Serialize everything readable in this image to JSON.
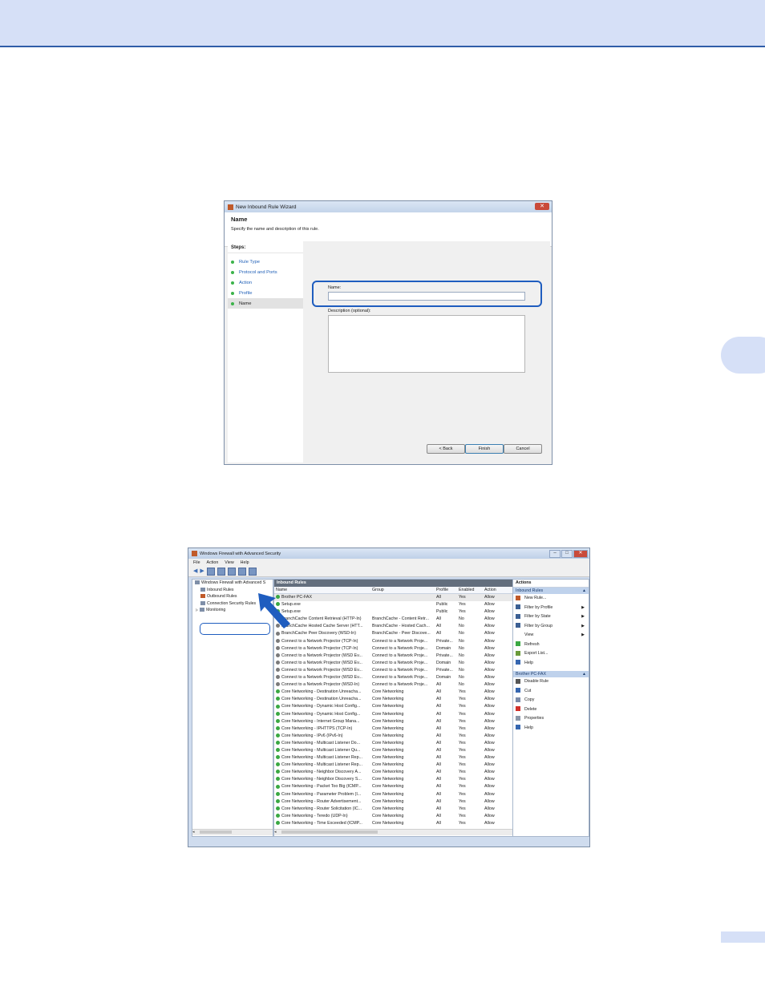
{
  "wizard": {
    "title": "New Inbound Rule Wizard",
    "heading": "Name",
    "subheading": "Specify the name and description of this rule.",
    "steps_label": "Steps:",
    "steps": [
      "Rule Type",
      "Protocol and Ports",
      "Action",
      "Profile",
      "Name"
    ],
    "name_label": "Name:",
    "name_value": "",
    "desc_label": "Description (optional):",
    "desc_value": "",
    "back_label": "< Back",
    "finish_label": "Finish",
    "cancel_label": "Cancel",
    "close_glyph": "✕"
  },
  "firewall": {
    "title": "Windows Firewall with Advanced Security",
    "menu": [
      "File",
      "Action",
      "View",
      "Help"
    ],
    "tree": [
      "Windows Firewall with Advanced S",
      "Inbound Rules",
      "Outbound Rules",
      "Connection Security Rules",
      "Monitoring"
    ],
    "grid_title": "Inbound Rules",
    "columns": [
      "Name",
      "Group",
      "Profile",
      "Enabled",
      "Action"
    ],
    "rows": [
      {
        "n": "Brother PC-FAX",
        "g": "",
        "p": "All",
        "e": "Yes",
        "a": "Allow",
        "i": "g"
      },
      {
        "n": "Setup.exe",
        "g": "",
        "p": "Public",
        "e": "Yes",
        "a": "Allow",
        "i": "g"
      },
      {
        "n": "Setup.exe",
        "g": "",
        "p": "Public",
        "e": "Yes",
        "a": "Allow",
        "i": "g"
      },
      {
        "n": "BranchCache Content Retrieval (HTTP-In)",
        "g": "BranchCache - Content Retr...",
        "p": "All",
        "e": "No",
        "a": "Allow",
        "i": "d"
      },
      {
        "n": "BranchCache Hosted Cache Server (HTT...",
        "g": "BranchCache - Hosted Cach...",
        "p": "All",
        "e": "No",
        "a": "Allow",
        "i": "d"
      },
      {
        "n": "BranchCache Peer Discovery (WSD-In)",
        "g": "BranchCache - Peer Discove...",
        "p": "All",
        "e": "No",
        "a": "Allow",
        "i": "d"
      },
      {
        "n": "Connect to a Network Projector (TCP-In)",
        "g": "Connect to a Network Proje...",
        "p": "Private...",
        "e": "No",
        "a": "Allow",
        "i": "d"
      },
      {
        "n": "Connect to a Network Projector (TCP-In)",
        "g": "Connect to a Network Proje...",
        "p": "Domain",
        "e": "No",
        "a": "Allow",
        "i": "d"
      },
      {
        "n": "Connect to a Network Projector (WSD Ev...",
        "g": "Connect to a Network Proje...",
        "p": "Private...",
        "e": "No",
        "a": "Allow",
        "i": "d"
      },
      {
        "n": "Connect to a Network Projector (WSD Ev...",
        "g": "Connect to a Network Proje...",
        "p": "Domain",
        "e": "No",
        "a": "Allow",
        "i": "d"
      },
      {
        "n": "Connect to a Network Projector (WSD Ev...",
        "g": "Connect to a Network Proje...",
        "p": "Private...",
        "e": "No",
        "a": "Allow",
        "i": "d"
      },
      {
        "n": "Connect to a Network Projector (WSD Ev...",
        "g": "Connect to a Network Proje...",
        "p": "Domain",
        "e": "No",
        "a": "Allow",
        "i": "d"
      },
      {
        "n": "Connect to a Network Projector (WSD-In)",
        "g": "Connect to a Network Proje...",
        "p": "All",
        "e": "No",
        "a": "Allow",
        "i": "d"
      },
      {
        "n": "Core Networking - Destination Unreacha...",
        "g": "Core Networking",
        "p": "All",
        "e": "Yes",
        "a": "Allow",
        "i": "g"
      },
      {
        "n": "Core Networking - Destination Unreacha...",
        "g": "Core Networking",
        "p": "All",
        "e": "Yes",
        "a": "Allow",
        "i": "g"
      },
      {
        "n": "Core Networking - Dynamic Host Config...",
        "g": "Core Networking",
        "p": "All",
        "e": "Yes",
        "a": "Allow",
        "i": "g"
      },
      {
        "n": "Core Networking - Dynamic Host Config...",
        "g": "Core Networking",
        "p": "All",
        "e": "Yes",
        "a": "Allow",
        "i": "g"
      },
      {
        "n": "Core Networking - Internet Group Mana...",
        "g": "Core Networking",
        "p": "All",
        "e": "Yes",
        "a": "Allow",
        "i": "g"
      },
      {
        "n": "Core Networking - IPHTTPS (TCP-In)",
        "g": "Core Networking",
        "p": "All",
        "e": "Yes",
        "a": "Allow",
        "i": "g"
      },
      {
        "n": "Core Networking - IPv6 (IPv6-In)",
        "g": "Core Networking",
        "p": "All",
        "e": "Yes",
        "a": "Allow",
        "i": "g"
      },
      {
        "n": "Core Networking - Multicast Listener Do...",
        "g": "Core Networking",
        "p": "All",
        "e": "Yes",
        "a": "Allow",
        "i": "g"
      },
      {
        "n": "Core Networking - Multicast Listener Qu...",
        "g": "Core Networking",
        "p": "All",
        "e": "Yes",
        "a": "Allow",
        "i": "g"
      },
      {
        "n": "Core Networking - Multicast Listener Rep...",
        "g": "Core Networking",
        "p": "All",
        "e": "Yes",
        "a": "Allow",
        "i": "g"
      },
      {
        "n": "Core Networking - Multicast Listener Rep...",
        "g": "Core Networking",
        "p": "All",
        "e": "Yes",
        "a": "Allow",
        "i": "g"
      },
      {
        "n": "Core Networking - Neighbor Discovery A...",
        "g": "Core Networking",
        "p": "All",
        "e": "Yes",
        "a": "Allow",
        "i": "g"
      },
      {
        "n": "Core Networking - Neighbor Discovery S...",
        "g": "Core Networking",
        "p": "All",
        "e": "Yes",
        "a": "Allow",
        "i": "g"
      },
      {
        "n": "Core Networking - Packet Too Big (ICMP...",
        "g": "Core Networking",
        "p": "All",
        "e": "Yes",
        "a": "Allow",
        "i": "g"
      },
      {
        "n": "Core Networking - Parameter Problem (I...",
        "g": "Core Networking",
        "p": "All",
        "e": "Yes",
        "a": "Allow",
        "i": "g"
      },
      {
        "n": "Core Networking - Router Advertisement...",
        "g": "Core Networking",
        "p": "All",
        "e": "Yes",
        "a": "Allow",
        "i": "g"
      },
      {
        "n": "Core Networking - Router Solicitation (IC...",
        "g": "Core Networking",
        "p": "All",
        "e": "Yes",
        "a": "Allow",
        "i": "g"
      },
      {
        "n": "Core Networking - Teredo (UDP-In)",
        "g": "Core Networking",
        "p": "All",
        "e": "Yes",
        "a": "Allow",
        "i": "g"
      },
      {
        "n": "Core Networking - Time Exceeded (ICMP...",
        "g": "Core Networking",
        "p": "All",
        "e": "Yes",
        "a": "Allow",
        "i": "g"
      }
    ],
    "actions_title": "Actions",
    "actions_section1": "Inbound Rules",
    "actions1": [
      {
        "label": "New Rule...",
        "icon": "new-rule-icon",
        "color": "#c05a2a",
        "arrow": ""
      },
      {
        "label": "Filter by Profile",
        "icon": "filter-icon",
        "color": "#3b5f93",
        "arrow": "▶"
      },
      {
        "label": "Filter by State",
        "icon": "filter-icon",
        "color": "#3b5f93",
        "arrow": "▶"
      },
      {
        "label": "Filter by Group",
        "icon": "filter-icon",
        "color": "#3b5f93",
        "arrow": "▶"
      },
      {
        "label": "View",
        "icon": "",
        "color": "",
        "arrow": "▶"
      },
      {
        "label": "Refresh",
        "icon": "refresh-icon",
        "color": "#3aa843",
        "arrow": ""
      },
      {
        "label": "Export List...",
        "icon": "export-icon",
        "color": "#6a9a3a",
        "arrow": ""
      },
      {
        "label": "Help",
        "icon": "help-icon",
        "color": "#3566b0",
        "arrow": ""
      }
    ],
    "actions_section2": "Brother PC-FAX",
    "actions2": [
      {
        "label": "Disable Rule",
        "icon": "disable-icon",
        "color": "#555555"
      },
      {
        "label": "Cut",
        "icon": "cut-icon",
        "color": "#3566b0"
      },
      {
        "label": "Copy",
        "icon": "copy-icon",
        "color": "#7a8aa8"
      },
      {
        "label": "Delete",
        "icon": "delete-icon",
        "color": "#d0302a"
      },
      {
        "label": "Properties",
        "icon": "properties-icon",
        "color": "#8a96a8"
      },
      {
        "label": "Help",
        "icon": "help-icon",
        "color": "#3566b0"
      }
    ]
  }
}
